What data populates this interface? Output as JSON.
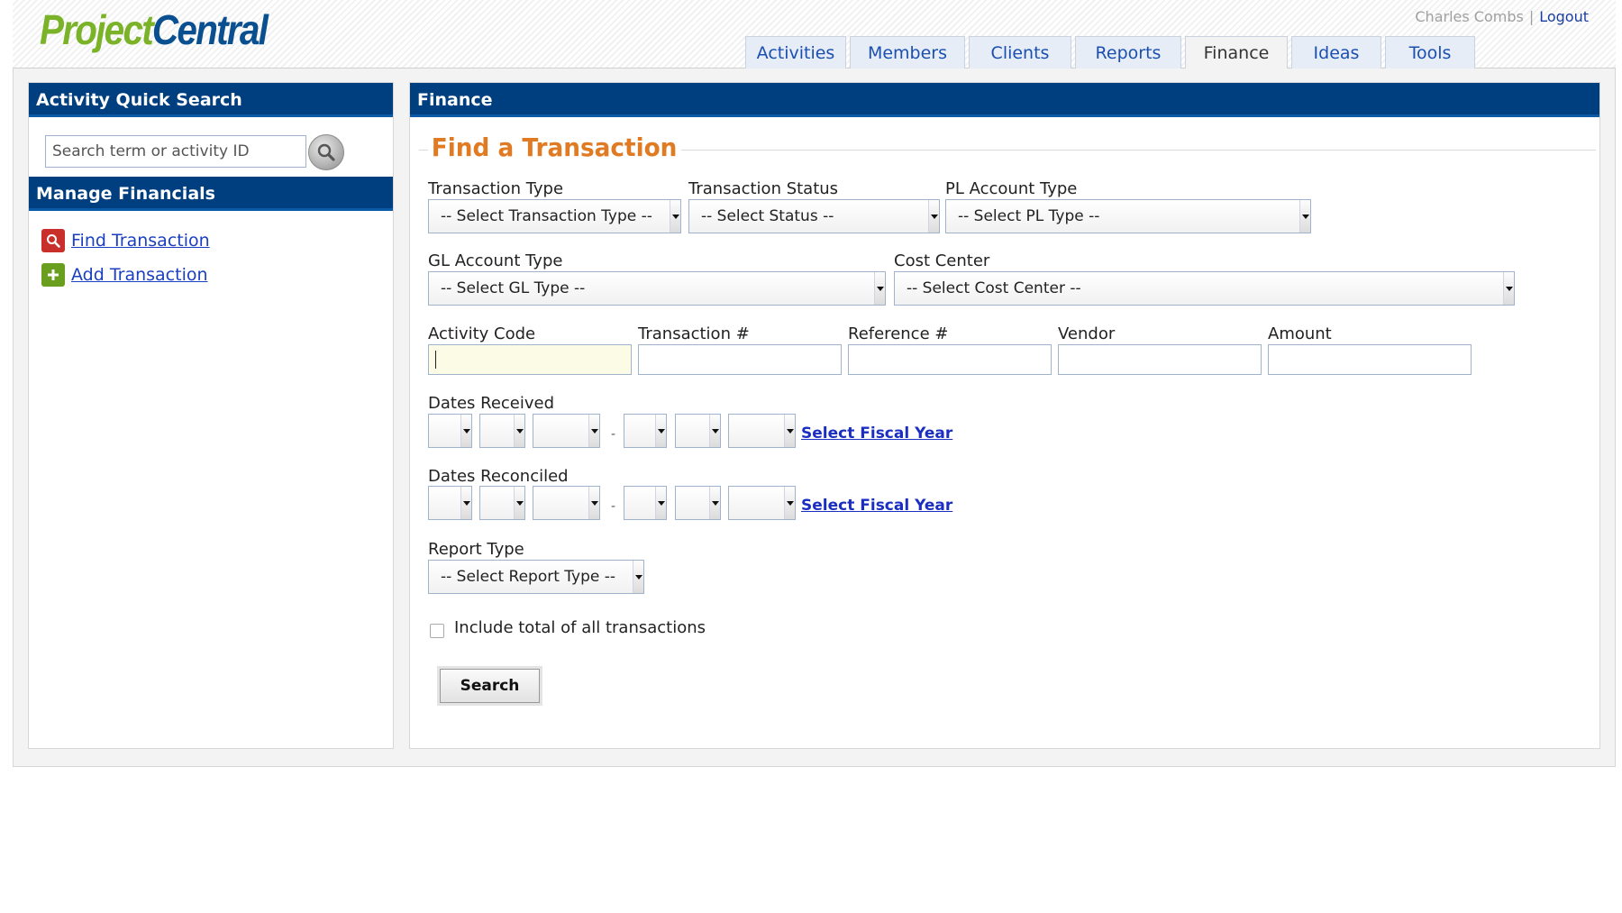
{
  "app": {
    "logo_part1": "Project",
    "logo_part2": "Central",
    "user_name": "Charles Combs",
    "separator": "|",
    "logout_label": "Logout"
  },
  "nav": {
    "tabs": [
      {
        "label": "Activities",
        "active": false
      },
      {
        "label": "Members",
        "active": false
      },
      {
        "label": "Clients",
        "active": false
      },
      {
        "label": "Reports",
        "active": false
      },
      {
        "label": "Finance",
        "active": true
      },
      {
        "label": "Ideas",
        "active": false
      },
      {
        "label": "Tools",
        "active": false
      }
    ]
  },
  "sidebar": {
    "quick_search_title": "Activity Quick Search",
    "search_placeholder": "Search term or activity ID",
    "search_value": "",
    "manage_title": "Manage Financials",
    "links": [
      {
        "label": "Find Transaction",
        "icon": "magnifier-icon"
      },
      {
        "label": "Add Transaction",
        "icon": "plus-icon"
      }
    ]
  },
  "main": {
    "section_title": "Finance",
    "form_title": "Find a Transaction",
    "fields": {
      "transaction_type": {
        "label": "Transaction Type",
        "value": "-- Select Transaction Type --"
      },
      "transaction_status": {
        "label": "Transaction Status",
        "value": "-- Select Status --"
      },
      "pl_account_type": {
        "label": "PL Account Type",
        "value": "-- Select PL Type --"
      },
      "gl_account_type": {
        "label": "GL Account Type",
        "value": "-- Select GL Type --"
      },
      "cost_center": {
        "label": "Cost Center",
        "value": "-- Select Cost Center --"
      },
      "activity_code": {
        "label": "Activity Code",
        "value": ""
      },
      "transaction_number": {
        "label": "Transaction #",
        "value": ""
      },
      "reference_number": {
        "label": "Reference #",
        "value": ""
      },
      "vendor": {
        "label": "Vendor",
        "value": ""
      },
      "amount": {
        "label": "Amount",
        "value": ""
      },
      "dates_received": {
        "label": "Dates Received",
        "range_separator": "-",
        "fiscal_link": "Select Fiscal Year"
      },
      "dates_reconciled": {
        "label": "Dates Reconciled",
        "range_separator": "-",
        "fiscal_link": "Select Fiscal Year"
      },
      "report_type": {
        "label": "Report Type",
        "value": "-- Select Report Type --"
      },
      "include_total": {
        "label": "Include total of all transactions",
        "checked": false
      }
    },
    "search_button": "Search"
  },
  "colors": {
    "header_bar": "#003f7f",
    "legend_orange": "#e07b24",
    "logo_green": "#7ab228",
    "logo_blue": "#0a4f8f",
    "link_blue": "#1a3fc0"
  }
}
